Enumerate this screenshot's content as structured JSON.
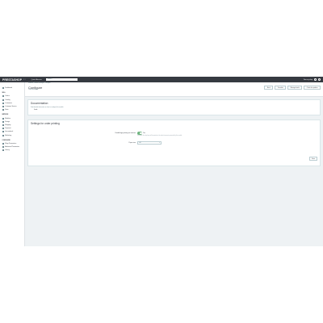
{
  "topbar": {
    "logo": "PRESTASHOP",
    "version": "8.1",
    "quick_access": "Quick Access",
    "search_placeholder": "Search",
    "shop_link": "View my shop",
    "notifications_icon": "bell-icon",
    "user_icon": "user-icon"
  },
  "sidebar": {
    "dashboard": "Dashboard",
    "sell_head": "Sell",
    "sell_items": [
      "Orders",
      "Catalog",
      "Customers",
      "Customer Service",
      "Stats"
    ],
    "improve_head": "Improve",
    "improve_items": [
      "Modules",
      "Design",
      "Shipping",
      "Payment",
      "International",
      "Marketing"
    ],
    "configure_head": "Configure",
    "configure_items": [
      "Shop Parameters",
      "Advanced Parameters",
      "Library"
    ]
  },
  "header": {
    "breadcrumb": "Modules / Module Manager / Configure",
    "title": "Configure",
    "subtitle": "Order documents",
    "buttons": [
      "Back",
      "Translate",
      "Manage hooks",
      "Check for updates"
    ]
  },
  "documentation": {
    "title": "Documentation",
    "text": "Find detailed information on how to configure this module:",
    "link": "Guide"
  },
  "settings": {
    "title": "Settings for order printing",
    "enable_label": "Enable logo printing on invoices",
    "enable_value": "Yes",
    "enable_help": "If enabled, the shop logo will be printed on the order documents generated by this module.",
    "paper_label": "Paper size",
    "paper_value": "A4",
    "save_label": "Save"
  }
}
